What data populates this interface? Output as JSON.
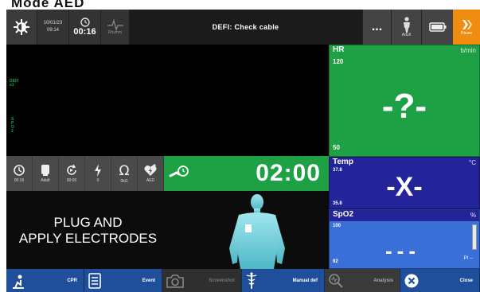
{
  "heading": "Mode AED",
  "topbar": {
    "brightness_icon": "sun-icon",
    "date": "10/01/23",
    "clock": "09:14",
    "timer": "00:16",
    "rhythm_label": "Rhythm",
    "message": "DEFI: Check cable",
    "more_label": "...",
    "patient_label": "Adult",
    "pause_label": "Pause"
  },
  "leads": {
    "defi_label": "DEFI\nx1",
    "spo2_label": "S\nP\nO\n2"
  },
  "status_row": {
    "items": [
      {
        "icon": "timer-icon",
        "label": "00:16"
      },
      {
        "icon": "patient-icon",
        "label": "Adult"
      },
      {
        "icon": "cycle-icon",
        "label": "00:00"
      },
      {
        "icon": "shock-icon",
        "label": "0"
      },
      {
        "icon": "impedance-icon",
        "label": "0kΩ"
      },
      {
        "icon": "aed-icon",
        "label": "AED"
      }
    ],
    "countdown": "02:00"
  },
  "message": {
    "line1": "PLUG AND",
    "line2": "APPLY ELECTRODES"
  },
  "hr": {
    "label": "HR",
    "unit": "b/min",
    "upper": "120",
    "lower": "50",
    "value": "-?-"
  },
  "temp": {
    "label": "Temp",
    "unit": "°C",
    "upper": "37.8",
    "lower": "35.8",
    "value": "-X-"
  },
  "spo2": {
    "label": "SpO2",
    "unit": "%",
    "upper": "100",
    "lower": "92",
    "value": "---",
    "pi": "PI --"
  },
  "bottombar": {
    "cpr": "CPR",
    "event": "Event",
    "screenshot": "Screenshot",
    "manual_def": "Manual def",
    "analysis": "Analysis",
    "close": "Close"
  },
  "colors": {
    "hr_panel": "#1ea045",
    "temp_panel": "#23239a",
    "spo2_panel": "#3a6fd8",
    "pause": "#f08c10",
    "bottom_blue": "#1f4f9b"
  }
}
